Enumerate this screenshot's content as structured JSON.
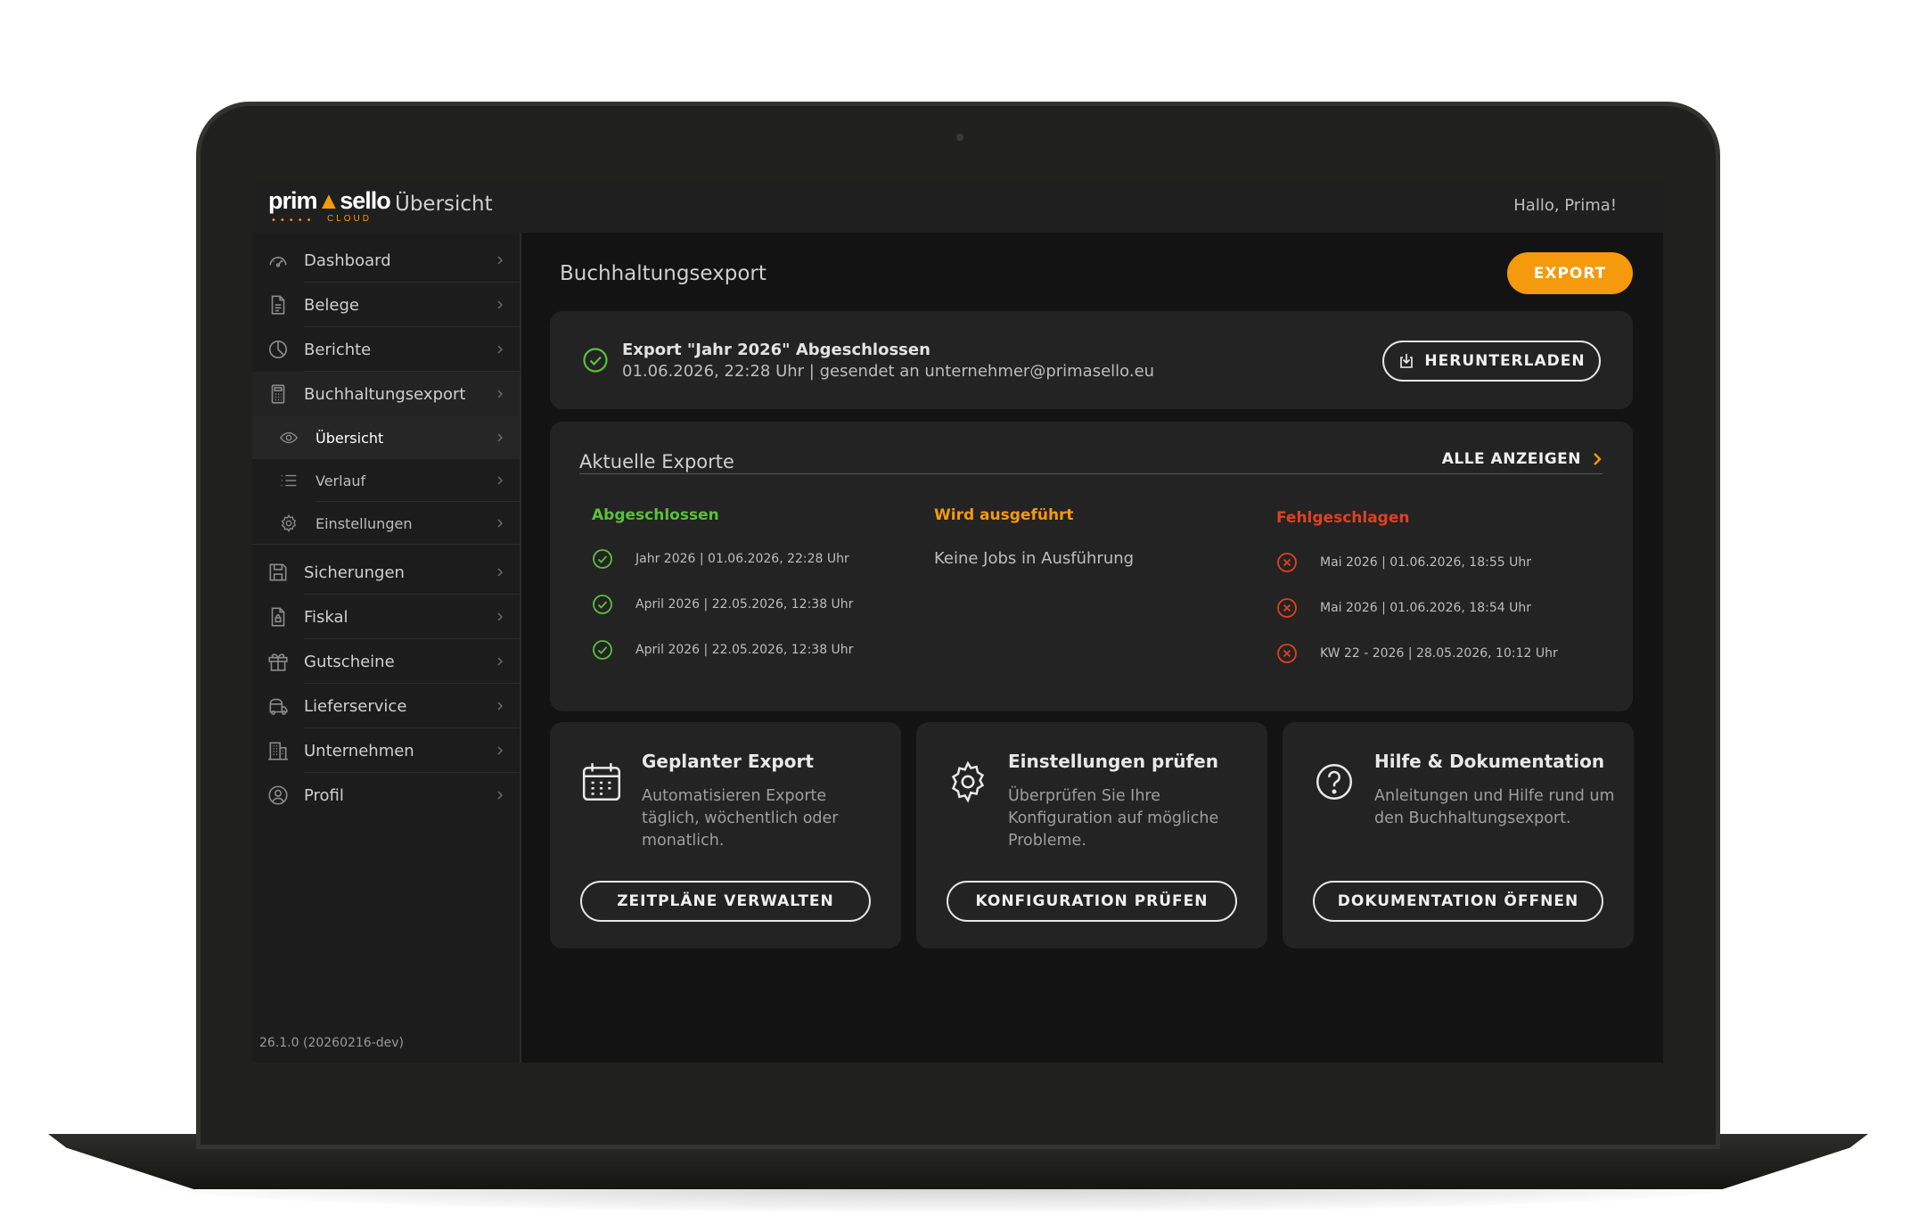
{
  "header": {
    "logo_text_a": "prim",
    "logo_text_b": "sello",
    "logo_sub": "CLOUD",
    "page_title": "Übersicht",
    "greeting": "Hallo, Prima!"
  },
  "sidebar": {
    "items": [
      {
        "label": "Dashboard",
        "icon": "gauge-icon"
      },
      {
        "label": "Belege",
        "icon": "document-icon"
      },
      {
        "label": "Berichte",
        "icon": "pie-chart-icon"
      },
      {
        "label": "Buchhaltungsexport",
        "icon": "calculator-icon"
      },
      {
        "label": "Sicherungen",
        "icon": "save-icon"
      },
      {
        "label": "Fiskal",
        "icon": "file-lock-icon"
      },
      {
        "label": "Gutscheine",
        "icon": "gift-icon"
      },
      {
        "label": "Lieferservice",
        "icon": "delivery-icon"
      },
      {
        "label": "Unternehmen",
        "icon": "building-icon"
      },
      {
        "label": "Profil",
        "icon": "user-icon"
      }
    ],
    "subitems": [
      {
        "label": "Übersicht",
        "icon": "eye-icon"
      },
      {
        "label": "Verlauf",
        "icon": "list-icon"
      },
      {
        "label": "Einstellungen",
        "icon": "gear-icon"
      }
    ],
    "version": "26.1.0 (20260216-dev)"
  },
  "main": {
    "heading": "Buchhaltungsexport",
    "export_button": "EXPORT",
    "status": {
      "title": "Export \"Jahr 2026\" Abgeschlossen",
      "subtitle": "01.06.2026, 22:28 Uhr | gesendet an unternehmer@primasello.eu",
      "download_button": "HERUNTERLADEN"
    },
    "recent": {
      "title": "Aktuelle Exporte",
      "show_all": "ALLE ANZEIGEN",
      "completed_label": "Abgeschlossen",
      "running_label": "Wird ausgeführt",
      "failed_label": "Fehlgeschlagen",
      "completed": [
        "Jahr 2026 | 01.06.2026, 22:28 Uhr",
        "April 2026 | 22.05.2026, 12:38 Uhr",
        "April 2026 | 22.05.2026, 12:38 Uhr"
      ],
      "running_empty": "Keine Jobs in Ausführung",
      "failed": [
        "Mai 2026 | 01.06.2026, 18:55 Uhr",
        "Mai 2026 | 01.06.2026, 18:54 Uhr",
        "KW 22 - 2026 | 28.05.2026, 10:12 Uhr"
      ]
    },
    "cards": [
      {
        "title": "Geplanter Export",
        "description": "Automatisieren Exporte täglich, wöchentlich oder monatlich.",
        "button": "ZEITPLÄNE VERWALTEN",
        "icon": "calendar-icon"
      },
      {
        "title": "Einstellungen prüfen",
        "description": "Überprüfen Sie Ihre Konfiguration auf mögliche Probleme.",
        "button": "KONFIGURATION PRÜFEN",
        "icon": "gear-icon"
      },
      {
        "title": "Hilfe & Dokumentation",
        "description": "Anleitungen und Hilfe rund um den Buchhaltungsexport.",
        "button": "DOKUMENTATION ÖFFNEN",
        "icon": "help-icon"
      }
    ]
  },
  "colors": {
    "accent": "#f49a0c",
    "success": "#5cbf3b",
    "error": "#e0401f",
    "background": "#131313",
    "card": "#232323"
  }
}
